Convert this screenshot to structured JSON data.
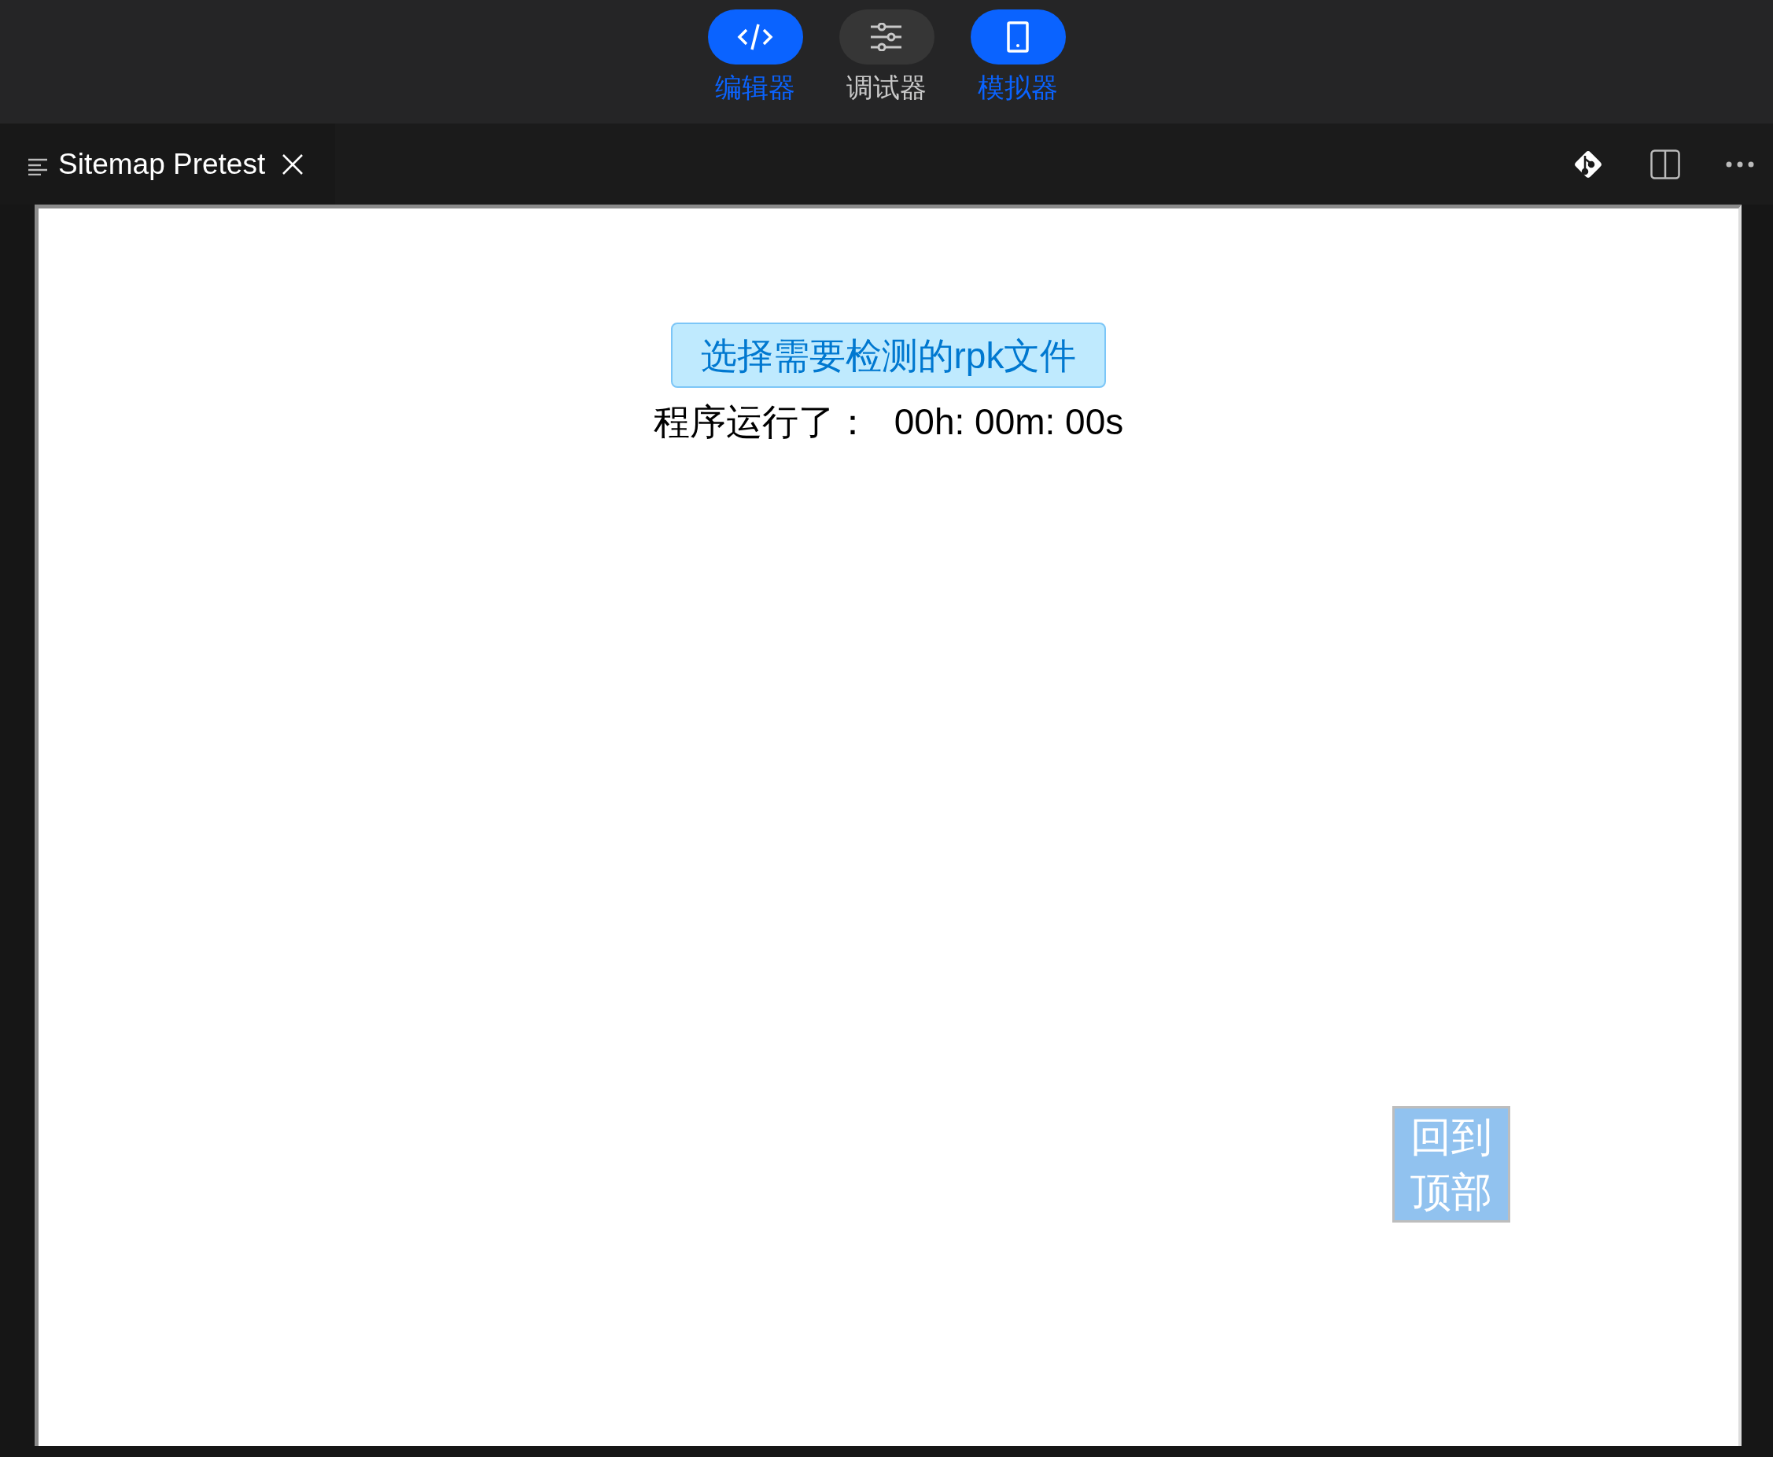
{
  "mode_switcher": [
    {
      "kind": "code",
      "label": "编辑器",
      "selected": true
    },
    {
      "kind": "sliders",
      "label": "调试器",
      "selected": false
    },
    {
      "kind": "phone",
      "label": "模拟器",
      "selected": true
    }
  ],
  "editor_tab": {
    "title": "Sitemap Pretest"
  },
  "preview": {
    "select_button": "选择需要检测的rpk文件",
    "runtime_label": "程序运行了：",
    "runtime_value": "00h: 00m: 00s",
    "back_to_top": [
      "回到",
      "顶部"
    ]
  }
}
